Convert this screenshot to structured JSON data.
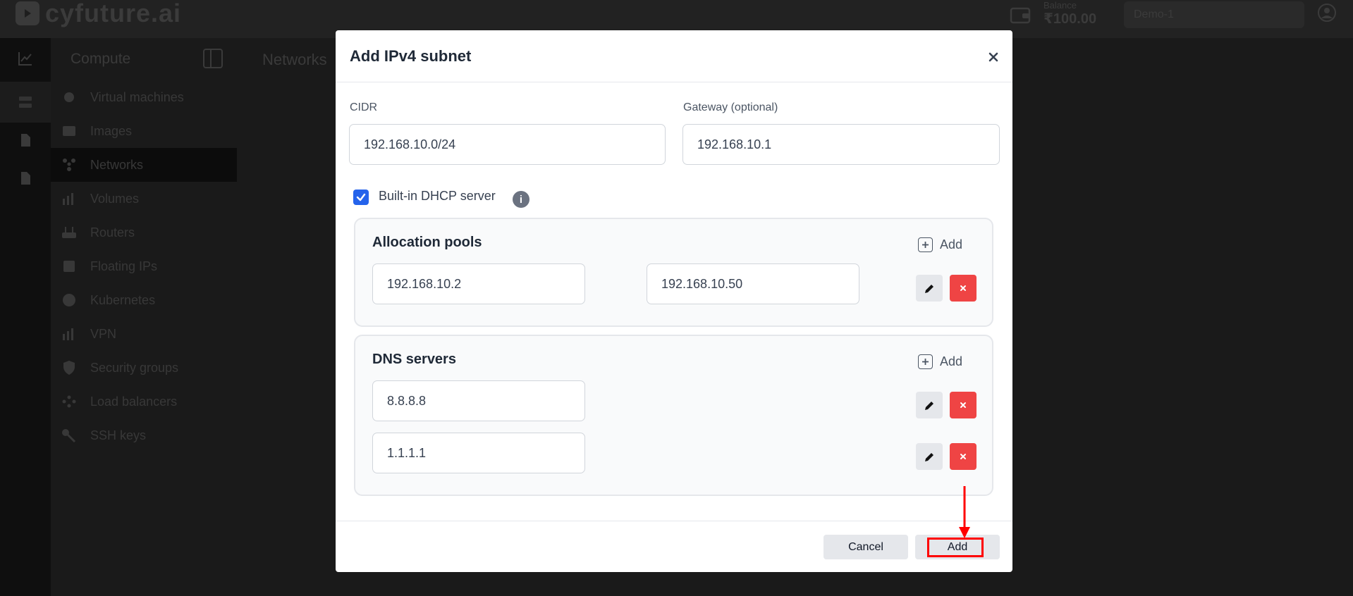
{
  "app": {
    "logo_text": "cyfuture.ai",
    "balance_label": "Balance",
    "balance_value": "₹100.00",
    "project": "Demo-1"
  },
  "sidebar": {
    "title": "Compute",
    "items": [
      {
        "label": "Virtual machines",
        "icon": "vm-icon"
      },
      {
        "label": "Images",
        "icon": "image-icon"
      },
      {
        "label": "Networks",
        "icon": "network-icon",
        "active": true
      },
      {
        "label": "Volumes",
        "icon": "volume-icon"
      },
      {
        "label": "Routers",
        "icon": "router-icon"
      },
      {
        "label": "Floating IPs",
        "icon": "floating-ip-icon"
      },
      {
        "label": "Kubernetes",
        "icon": "kubernetes-icon"
      },
      {
        "label": "VPN",
        "icon": "vpn-icon"
      },
      {
        "label": "Security groups",
        "icon": "shield-icon"
      },
      {
        "label": "Load balancers",
        "icon": "load-balancer-icon"
      },
      {
        "label": "SSH keys",
        "icon": "key-icon"
      }
    ]
  },
  "breadcrumb": "Networks",
  "modal": {
    "title": "Add IPv4 subnet",
    "cidr_label": "CIDR",
    "cidr_value": "192.168.10.0/24",
    "gateway_label": "Gateway (optional)",
    "gateway_value": "192.168.10.1",
    "dhcp_label": "Built-in DHCP server",
    "dhcp_checked": true,
    "info_glyph": "i",
    "allocation_pools": {
      "title": "Allocation pools",
      "add_label": "Add",
      "pools": [
        {
          "start": "192.168.10.2",
          "end": "192.168.10.50"
        }
      ]
    },
    "dns_servers": {
      "title": "DNS servers",
      "add_label": "Add",
      "servers": [
        "8.8.8.8",
        "1.1.1.1"
      ]
    },
    "cancel_label": "Cancel",
    "submit_label": "Add"
  },
  "colors": {
    "primary_check": "#2563eb",
    "delete_red": "#ef4444",
    "highlight_red": "#ff0000"
  }
}
